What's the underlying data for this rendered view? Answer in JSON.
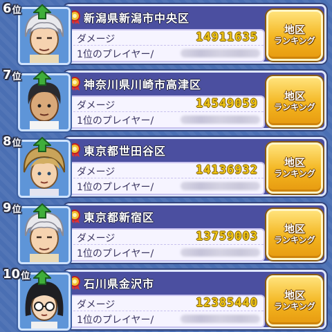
{
  "ranking": {
    "entries": [
      {
        "rank": "6",
        "rank_suffix": "位",
        "area": "新潟県新潟市中央区",
        "damage_label": "ダメージ",
        "damage": "14911635",
        "top_player_label": "1位のプレイヤー/",
        "button_line1": "地区",
        "button_line2": "ランキング",
        "avatar": "elder-white-hair"
      },
      {
        "rank": "7",
        "rank_suffix": "位",
        "area": "神奈川県川崎市高津区",
        "damage_label": "ダメージ",
        "damage": "14549059",
        "top_player_label": "1位のプレイヤー/",
        "button_line1": "地区",
        "button_line2": "ランキング",
        "avatar": "boy-black-hair"
      },
      {
        "rank": "8",
        "rank_suffix": "位",
        "area": "東京都世田谷区",
        "damage_label": "ダメージ",
        "damage": "14136932",
        "top_player_label": "1位のプレイヤー/",
        "button_line1": "地区",
        "button_line2": "ランキング",
        "avatar": "boy-blond-hair"
      },
      {
        "rank": "9",
        "rank_suffix": "位",
        "area": "東京都新宿区",
        "damage_label": "ダメージ",
        "damage": "13759003",
        "top_player_label": "1位のプレイヤー/",
        "button_line1": "地区",
        "button_line2": "ランキング",
        "avatar": "elder-white-hair"
      },
      {
        "rank": "10",
        "rank_suffix": "位",
        "area": "石川県金沢市",
        "damage_label": "ダメージ",
        "damage": "12385440",
        "top_player_label": "1位のプレイヤー/",
        "button_line1": "地区",
        "button_line2": "ランキング",
        "avatar": "girl-glasses"
      }
    ]
  },
  "colors": {
    "background": "#4a6fb3",
    "card": "#4b4fa0",
    "damage_value": "#f0c618",
    "button": "#f3b51f",
    "arrow": "#3fae3a"
  },
  "icons": {
    "rank_change": "green-up-arrow-icon",
    "area": "red-medal-icon"
  }
}
